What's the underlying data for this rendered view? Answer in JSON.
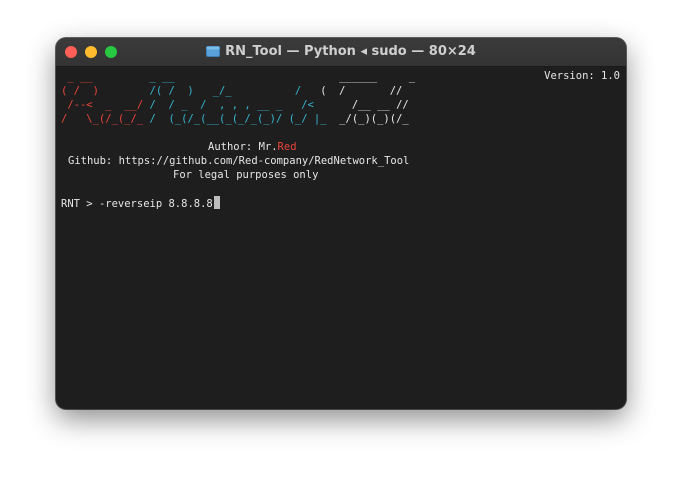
{
  "window": {
    "title": "RN_Tool — Python ◂ sudo — 80×24"
  },
  "terminal": {
    "version": "Version: 1.0",
    "banner": {
      "line1_red": " _ __  ",
      "line1_cyan": "       _ __            ",
      "line1_white": "              ______     _",
      "line2_red": "( /  )  ",
      "line2_cyan": "      /( /  )   _/_          /  ",
      "line2_white": " (  /       //",
      "line3_red": " /--<  _  __/ ",
      "line3_cyan": "/  / _  /  , , , __ _   /<  ",
      "line3_white": "    /__ __ //",
      "line4_red": "/   \\_(/_(_/_ ",
      "line4_cyan": "/  (_(/_(__(_(_/_(_)/ (_/ |_  ",
      "line4_white": "_/(_)(_)(/_"
    },
    "author_label": "Author: Mr.",
    "author_name": "Red",
    "github": "Github: https://github.com/Red-company/RedNetwork_Tool",
    "legal": "For legal purposes only",
    "prompt": "RNT > ",
    "command": "-reverseip 8.8.8.8"
  },
  "colors": {
    "accent_red": "#e8453c",
    "accent_cyan": "#38b6d0",
    "terminal_bg": "#1e1e1e"
  }
}
